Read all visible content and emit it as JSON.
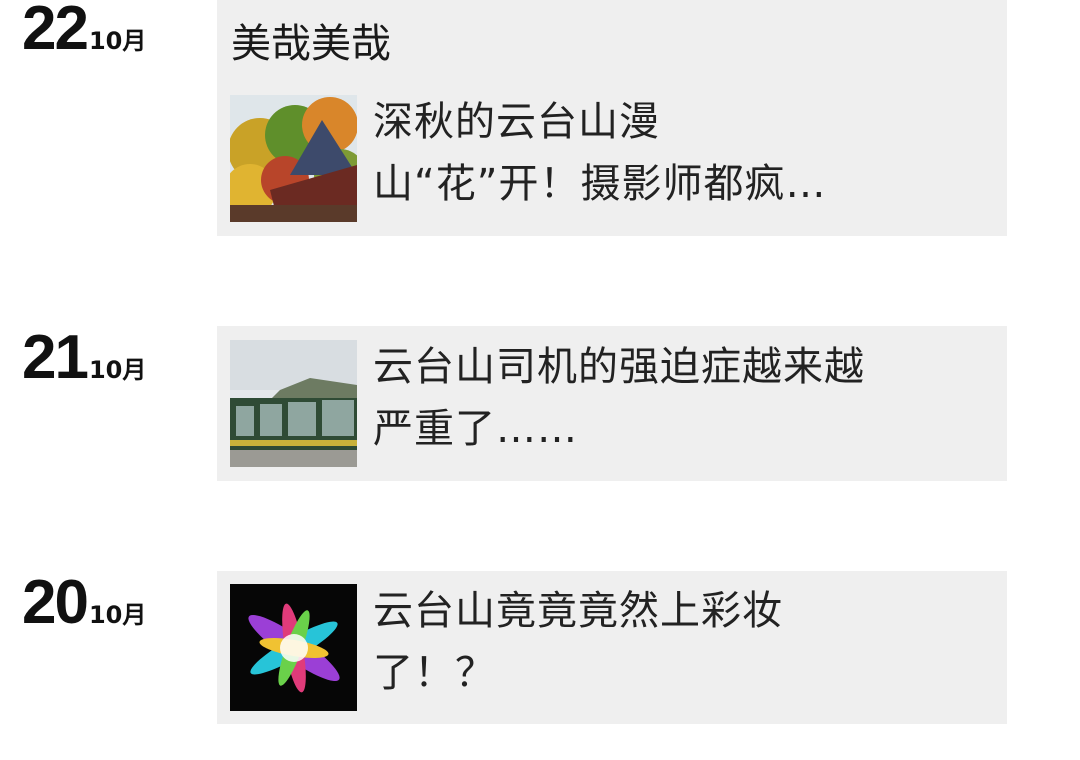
{
  "entries": [
    {
      "day": "22",
      "month": "10月",
      "account": "美哉美哉",
      "article_title_line1": "深秋的云台山漫",
      "article_title_line2": "山“花”开！摄影师都疯…",
      "thumbnail": "autumn-temple-thumbnail"
    },
    {
      "day": "21",
      "month": "10月",
      "article_title_line1": "云台山司机的强迫症越来越",
      "article_title_line2": "严重了……",
      "thumbnail": "buses-thumbnail"
    },
    {
      "day": "20",
      "month": "10月",
      "article_title_line1": "云台山竟竟竟然上彩妆",
      "article_title_line2": "了！？",
      "thumbnail": "color-powder-thumbnail"
    }
  ]
}
